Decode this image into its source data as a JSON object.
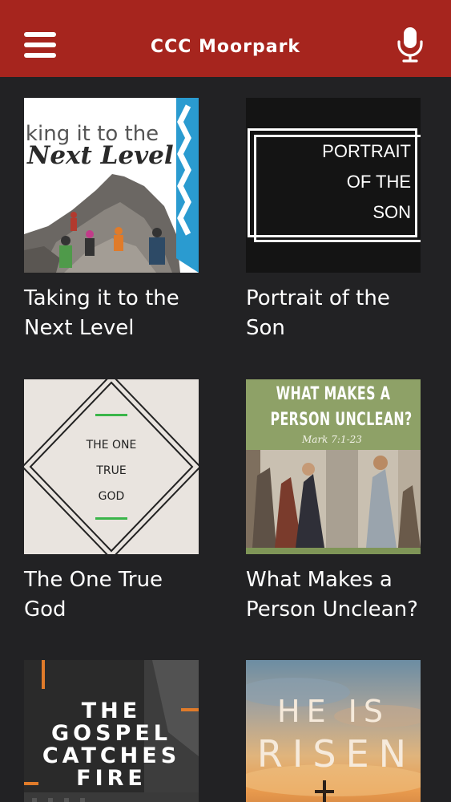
{
  "header": {
    "title": "CCC Moorpark",
    "menu_icon": "hamburger-menu-icon",
    "mic_icon": "microphone-icon",
    "background": "#a6251e"
  },
  "series": [
    {
      "title_lines": [
        "Taking it to the",
        "Next Level"
      ],
      "art": {
        "line1": "aking it to the",
        "line2": "Next Level"
      }
    },
    {
      "title_lines": [
        "Portrait of the",
        "Son"
      ],
      "art": {
        "lines": [
          "PORTRAIT",
          "OF THE",
          "SON"
        ]
      }
    },
    {
      "title_lines": [
        "The One True",
        "God"
      ],
      "art": {
        "lines": [
          "THE ONE",
          "TRUE",
          "GOD"
        ]
      }
    },
    {
      "title_lines": [
        "What Makes a",
        "Person Unclean?"
      ],
      "art": {
        "line1": "WHAT MAKES A",
        "line2": "PERSON UNCLEAN?",
        "reference": "Mark 7:1-23"
      }
    },
    {
      "title_lines": [],
      "art": {
        "lines": [
          "THE",
          "GOSPEL",
          "CATCHES",
          "FIRE"
        ]
      }
    },
    {
      "title_lines": [],
      "art": {
        "line1": "HE IS",
        "line2": "RISEN"
      }
    }
  ]
}
